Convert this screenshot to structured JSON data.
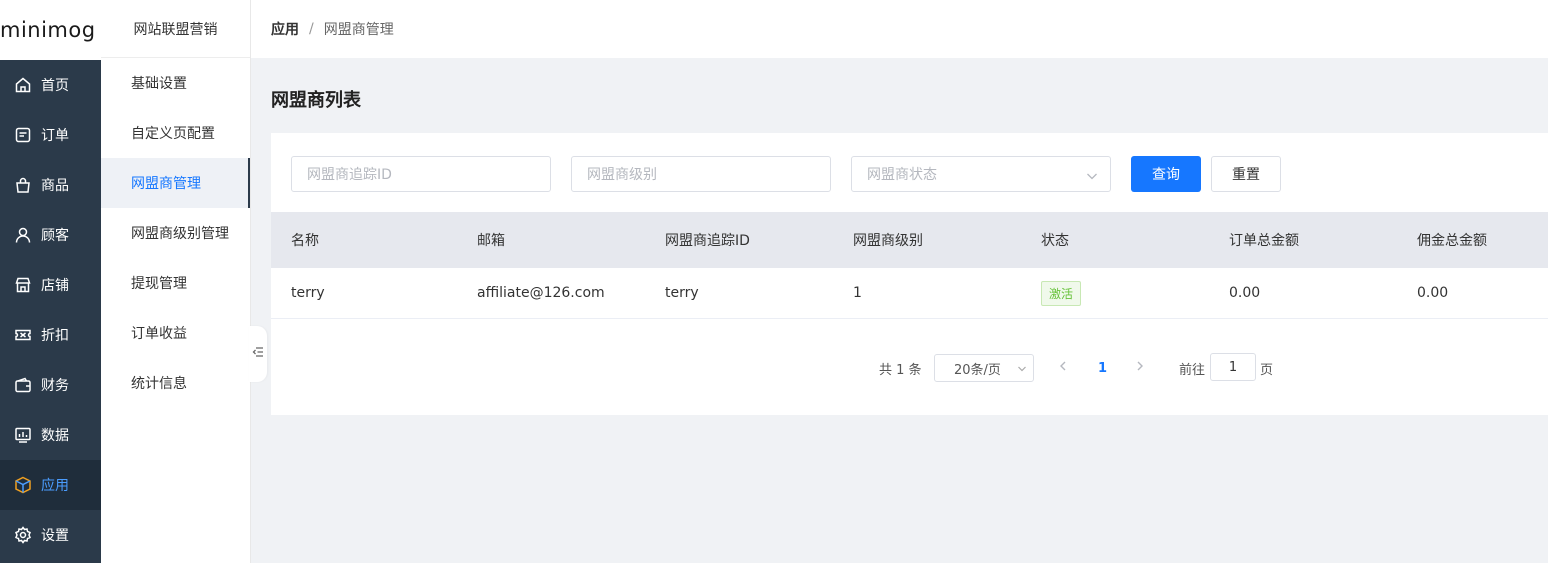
{
  "app": {
    "logo_text": "minimog"
  },
  "nav": {
    "items": [
      {
        "label": "首页",
        "icon": "home-icon"
      },
      {
        "label": "订单",
        "icon": "order-icon"
      },
      {
        "label": "商品",
        "icon": "bag-icon"
      },
      {
        "label": "顾客",
        "icon": "user-icon"
      },
      {
        "label": "店铺",
        "icon": "store-icon"
      },
      {
        "label": "折扣",
        "icon": "ticket-icon"
      },
      {
        "label": "财务",
        "icon": "wallet-icon"
      },
      {
        "label": "数据",
        "icon": "chart-icon"
      },
      {
        "label": "应用",
        "icon": "cube-icon",
        "active": true
      },
      {
        "label": "设置",
        "icon": "gear-icon"
      }
    ],
    "active_color": "#4b9dff"
  },
  "submenu": {
    "title": "网站联盟营销",
    "items": [
      {
        "label": "基础设置"
      },
      {
        "label": "自定义页配置"
      },
      {
        "label": "网盟商管理",
        "active": true
      },
      {
        "label": "网盟商级别管理"
      },
      {
        "label": "提现管理"
      },
      {
        "label": "订单收益"
      },
      {
        "label": "统计信息"
      }
    ]
  },
  "breadcrumb": {
    "parent": "应用",
    "separator": "/",
    "current": "网盟商管理"
  },
  "page": {
    "title": "网盟商列表"
  },
  "filters": {
    "tracking_id_placeholder": "网盟商追踪ID",
    "level_placeholder": "网盟商级别",
    "status_placeholder": "网盟商状态",
    "search_label": "查询",
    "reset_label": "重置"
  },
  "table": {
    "columns": [
      "名称",
      "邮箱",
      "网盟商追踪ID",
      "网盟商级别",
      "状态",
      "订单总金额",
      "佣金总金额"
    ],
    "rows": [
      {
        "name": "terry",
        "email": "affiliate@126.com",
        "tracking_id": "terry",
        "level": "1",
        "status": "激活",
        "order_total": "0.00",
        "commission_total": "0.00"
      }
    ]
  },
  "pagination": {
    "total_text": "共 1 条",
    "page_size": "20条/页",
    "current_page": "1",
    "goto_label": "前往",
    "goto_value": "1",
    "page_suffix": "页"
  },
  "colors": {
    "primary": "#1677ff",
    "nav_bg": "#2b3a4a",
    "status_active": "#67c23a"
  }
}
